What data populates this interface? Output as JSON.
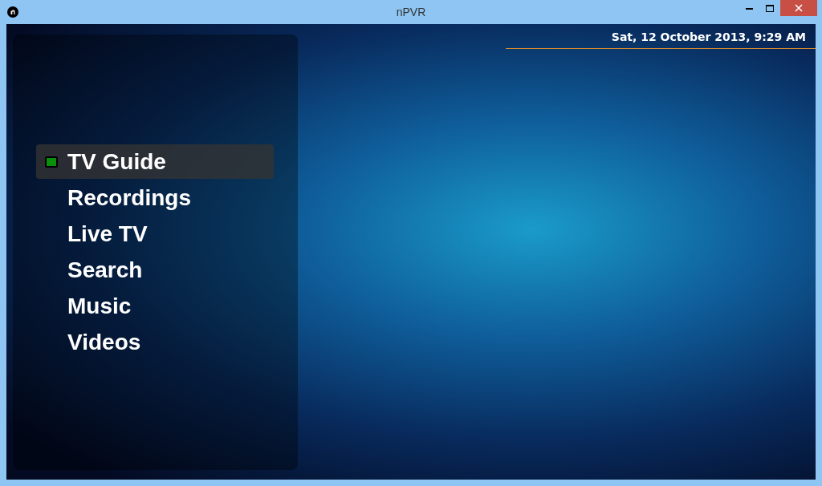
{
  "window": {
    "title": "nPVR"
  },
  "datetime": "Sat, 12 October 2013, 9:29 AM",
  "menu": [
    {
      "label": "TV Guide",
      "selected": true
    },
    {
      "label": "Recordings",
      "selected": false
    },
    {
      "label": "Live TV",
      "selected": false
    },
    {
      "label": "Search",
      "selected": false
    },
    {
      "label": "Music",
      "selected": false
    },
    {
      "label": "Videos",
      "selected": false
    }
  ]
}
